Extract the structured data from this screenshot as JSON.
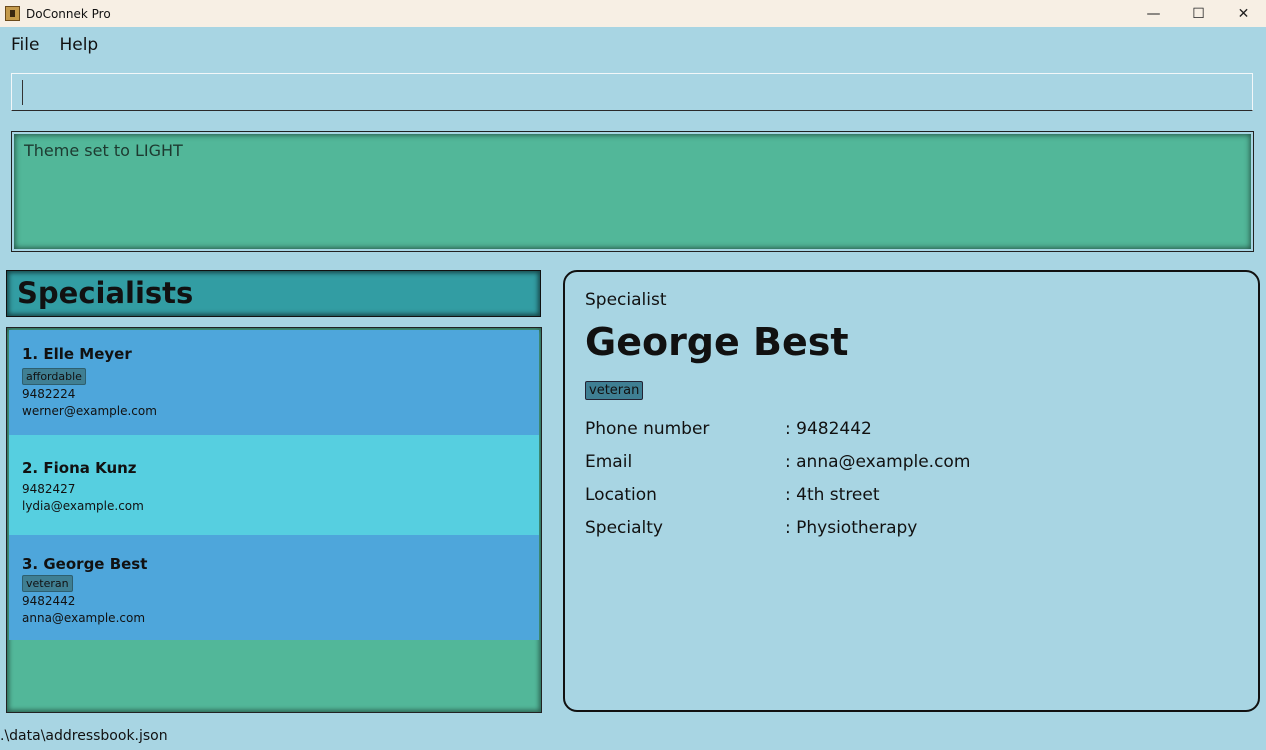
{
  "window": {
    "title": "DoConnek Pro",
    "controls": {
      "minimize": "—",
      "maximize": "☐",
      "close": "✕"
    }
  },
  "menu": {
    "items": [
      "File",
      "Help"
    ]
  },
  "command_box": {
    "value": ""
  },
  "result_display": {
    "text": "Theme set to LIGHT"
  },
  "list": {
    "header": "Specialists",
    "items": [
      {
        "index": "1.",
        "name": "Elle Meyer",
        "tag": "affordable",
        "phone": "9482224",
        "email": "werner@example.com"
      },
      {
        "index": "2.",
        "name": "Fiona Kunz",
        "tag": "",
        "phone": "9482427",
        "email": "lydia@example.com"
      },
      {
        "index": "3.",
        "name": "George Best",
        "tag": "veteran",
        "phone": "9482442",
        "email": "anna@example.com"
      }
    ]
  },
  "detail": {
    "type": "Specialist",
    "name": "George Best",
    "tag": "veteran",
    "fields": [
      {
        "label": "Phone number",
        "value": ": 9482442"
      },
      {
        "label": "Email",
        "value": ": anna@example.com"
      },
      {
        "label": "Location",
        "value": ": 4th street"
      },
      {
        "label": "Specialty",
        "value": ": Physiotherapy"
      }
    ]
  },
  "status_bar": {
    "path": ".\\data\\addressbook.json"
  },
  "colors": {
    "background": "#a8d5e3",
    "result_green": "#52b799",
    "header_teal": "#329da3",
    "card_blue": "#4ea6db",
    "card_cyan": "#56cfe0",
    "tag": "#3f7f93"
  }
}
